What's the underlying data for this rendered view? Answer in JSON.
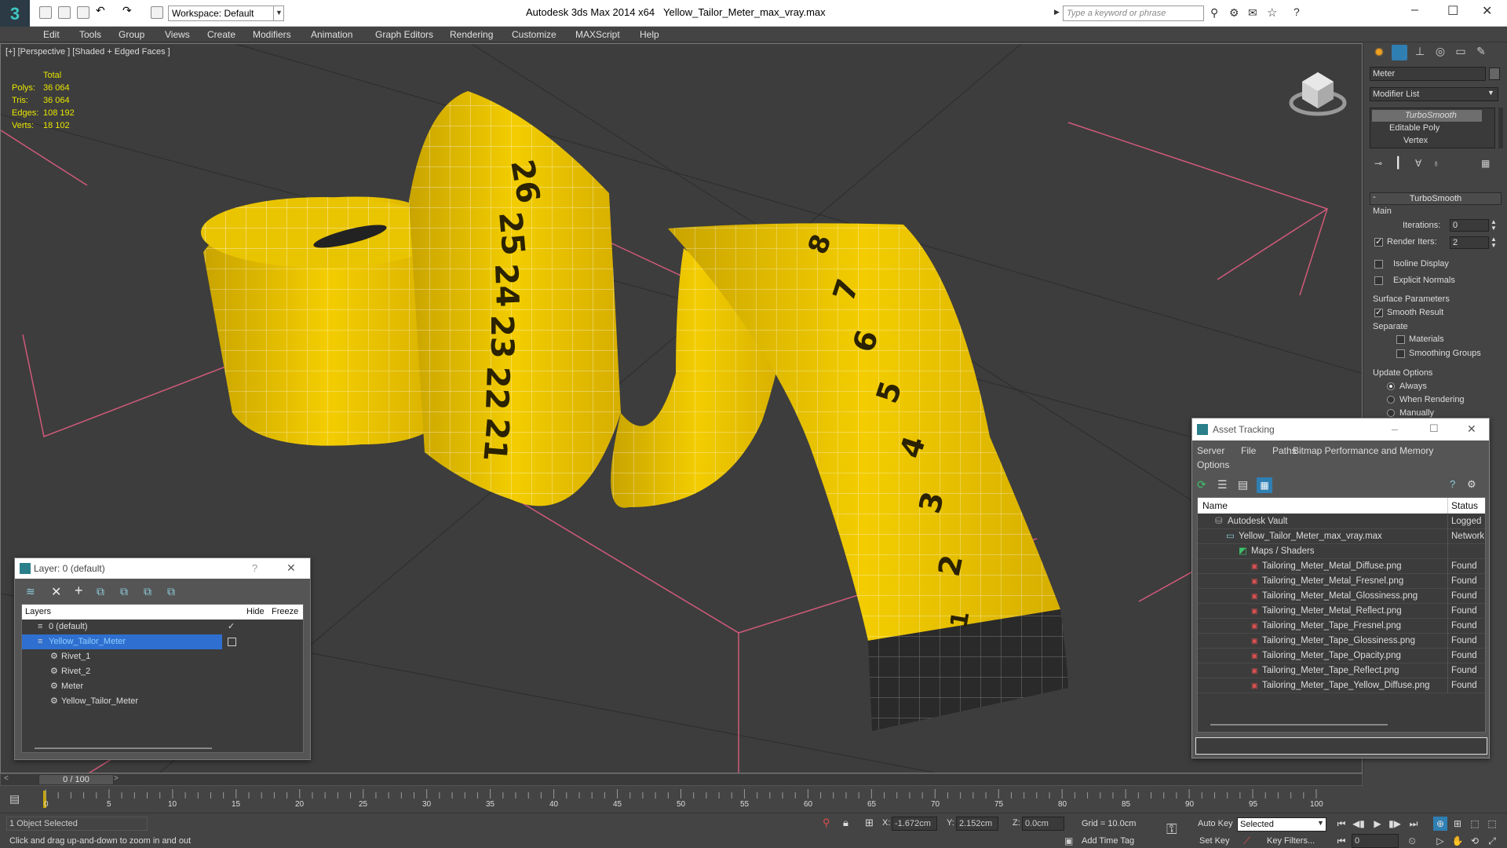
{
  "app": {
    "title": "Autodesk 3ds Max  2014 x64",
    "file": "Yellow_Tailor_Meter_max_vray.max",
    "workspace": "Workspace: Default",
    "search_placeholder": "Type a keyword or phrase"
  },
  "menu": [
    "Edit",
    "Tools",
    "Group",
    "Views",
    "Create",
    "Modifiers",
    "Animation",
    "Graph Editors",
    "Rendering",
    "Customize",
    "MAXScript",
    "Help"
  ],
  "viewport": {
    "label": "[+] [Perspective ] [Shaded + Edged Faces ]",
    "stats": {
      "header": "Total",
      "rows": [
        {
          "k": "Polys:",
          "v": "36 064"
        },
        {
          "k": "Tris:",
          "v": "36 064"
        },
        {
          "k": "Edges:",
          "v": "108 192"
        },
        {
          "k": "Verts:",
          "v": "18 102"
        }
      ]
    },
    "tape_numbers_roll": [
      "26",
      "25",
      "24",
      "23",
      "22",
      "21"
    ],
    "tape_numbers_strip": [
      "8",
      "7",
      "6",
      "5",
      "4",
      "3",
      "2",
      "1"
    ]
  },
  "command_panel": {
    "object_name": "Meter",
    "modifier_list": "Modifier List",
    "stack": [
      "TurboSmooth",
      "Editable Poly",
      "Vertex"
    ],
    "rollout_title": "TurboSmooth",
    "main_label": "Main",
    "iterations_label": "Iterations:",
    "iterations_value": "0",
    "render_iters_label": "Render Iters:",
    "render_iters_value": "2",
    "isoline": "Isoline Display",
    "explicit_normals": "Explicit Normals",
    "surface_params": "Surface Parameters",
    "smooth_result": "Smooth Result",
    "separate": "Separate",
    "materials": "Materials",
    "smoothing_groups": "Smoothing Groups",
    "update_options": "Update Options",
    "always": "Always",
    "when_rendering": "When Rendering",
    "manually": "Manually"
  },
  "layer_window": {
    "title": "Layer: 0 (default)",
    "help": "?",
    "columns": [
      "Layers",
      "Hide",
      "Freeze"
    ],
    "rows": [
      "0 (default)",
      "Yellow_Tailor_Meter",
      "Rivet_1",
      "Rivet_2",
      "Meter",
      "Yellow_Tailor_Meter"
    ]
  },
  "asset_window": {
    "title": "Asset Tracking",
    "menu": [
      "Server",
      "File",
      "Paths",
      "Bitmap Performance and Memory",
      "Options"
    ],
    "columns": [
      "Name",
      "Status"
    ],
    "rows": [
      {
        "name": "Autodesk Vault",
        "status": "Logged O"
      },
      {
        "name": "Yellow_Tailor_Meter_max_vray.max",
        "status": "Network P"
      },
      {
        "name": "Maps / Shaders",
        "status": ""
      },
      {
        "name": "Tailoring_Meter_Metal_Diffuse.png",
        "status": "Found"
      },
      {
        "name": "Tailoring_Meter_Metal_Fresnel.png",
        "status": "Found"
      },
      {
        "name": "Tailoring_Meter_Metal_Glossiness.png",
        "status": "Found"
      },
      {
        "name": "Tailoring_Meter_Metal_Reflect.png",
        "status": "Found"
      },
      {
        "name": "Tailoring_Meter_Tape_Fresnel.png",
        "status": "Found"
      },
      {
        "name": "Tailoring_Meter_Tape_Glossiness.png",
        "status": "Found"
      },
      {
        "name": "Tailoring_Meter_Tape_Opacity.png",
        "status": "Found"
      },
      {
        "name": "Tailoring_Meter_Tape_Reflect.png",
        "status": "Found"
      },
      {
        "name": "Tailoring_Meter_Tape_Yellow_Diffuse.png",
        "status": "Found"
      }
    ]
  },
  "timeline": {
    "frame": "0 / 100",
    "ticks": [
      "0",
      "5",
      "10",
      "15",
      "20",
      "25",
      "30",
      "35",
      "40",
      "45",
      "50",
      "55",
      "60",
      "65",
      "70",
      "75",
      "80",
      "85",
      "90",
      "95",
      "100"
    ]
  },
  "status": {
    "selected": "1 Object Selected",
    "prompt": "Click and drag up-and-down to zoom in and out",
    "x": "-1.672cm",
    "y": "2.152cm",
    "z": "0.0cm",
    "grid": "Grid = 10.0cm",
    "auto_key": "Auto Key",
    "set_key": "Set Key",
    "selected_dropdown": "Selected",
    "key_filters": "Key Filters...",
    "add_time_tag": "Add Time Tag",
    "frame_value": "0",
    "x_label": "X:",
    "y_label": "Y:",
    "z_label": "Z:"
  }
}
